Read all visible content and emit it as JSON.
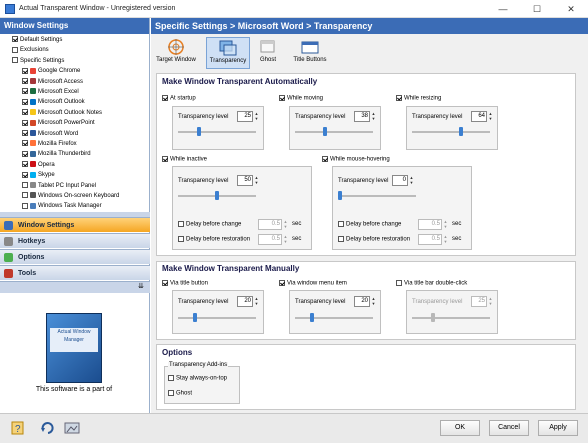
{
  "window": {
    "title": "Actual Transparent Window - Unregistered version",
    "min": "—",
    "max": "☐",
    "close": "✕"
  },
  "left": {
    "title": "Window Settings",
    "tree": [
      {
        "label": "Default Settings",
        "checked": true,
        "indent": 0
      },
      {
        "label": "Exclusions",
        "checked": false,
        "indent": 0
      },
      {
        "label": "Specific Settings",
        "checked": false,
        "indent": 0
      },
      {
        "label": "Google Chrome",
        "checked": true,
        "indent": 1,
        "color": "#e94235"
      },
      {
        "label": "Microsoft Access",
        "checked": true,
        "indent": 1,
        "color": "#a4373a"
      },
      {
        "label": "Microsoft Excel",
        "checked": true,
        "indent": 1,
        "color": "#1d6f42"
      },
      {
        "label": "Microsoft Outlook",
        "checked": true,
        "indent": 1,
        "color": "#0072c6"
      },
      {
        "label": "Microsoft Outlook Notes",
        "checked": true,
        "indent": 1,
        "color": "#f5c518"
      },
      {
        "label": "Microsoft PowerPoint",
        "checked": true,
        "indent": 1,
        "color": "#d24726"
      },
      {
        "label": "Microsoft Word",
        "checked": true,
        "indent": 1,
        "color": "#2b579a"
      },
      {
        "label": "Mozilla Firefox",
        "checked": true,
        "indent": 1,
        "color": "#ff7139"
      },
      {
        "label": "Mozilla Thunderbird",
        "checked": true,
        "indent": 1,
        "color": "#336699"
      },
      {
        "label": "Opera",
        "checked": true,
        "indent": 1,
        "color": "#cc0f16"
      },
      {
        "label": "Skype",
        "checked": true,
        "indent": 1,
        "color": "#00aff0"
      },
      {
        "label": "Tablet PC Input Panel",
        "checked": false,
        "indent": 1,
        "color": "#888888"
      },
      {
        "label": "Windows On-screen Keyboard",
        "checked": false,
        "indent": 1,
        "color": "#555555"
      },
      {
        "label": "Windows Task Manager",
        "checked": false,
        "indent": 1,
        "color": "#4a7ebb"
      }
    ],
    "nav": [
      "Window Settings",
      "Hotkeys",
      "Options",
      "Tools"
    ],
    "promo_box_text": "Actual Window Manager",
    "promo_text": "This software is a part of"
  },
  "right": {
    "breadcrumb": "Specific Settings > Microsoft Word > Transparency",
    "tools": [
      "Target Window",
      "Transparency",
      "Ghost",
      "Title Buttons"
    ],
    "auto": {
      "title": "Make Window Transparent Automatically",
      "startup": {
        "label": "At startup",
        "level_label": "Transparency level",
        "value": "25"
      },
      "moving": {
        "label": "While moving",
        "level_label": "Transparency level",
        "value": "38"
      },
      "resizing": {
        "label": "While resizing",
        "level_label": "Transparency level",
        "value": "64"
      },
      "inactive": {
        "label": "While inactive",
        "level_label": "Transparency level",
        "value": "50",
        "delay_change": "Delay before change",
        "delay_change_val": "0.5",
        "delay_restore": "Delay before restoration",
        "delay_restore_val": "0.5",
        "unit": "sec"
      },
      "hovering": {
        "label": "While mouse-hovering",
        "level_label": "Transparency level",
        "value": "0",
        "delay_change": "Delay before change",
        "delay_change_val": "0.5",
        "delay_restore": "Delay before restoration",
        "delay_restore_val": "0.5",
        "unit": "sec"
      }
    },
    "manual": {
      "title": "Make Window Transparent Manually",
      "title_button": {
        "label": "Via title button",
        "level_label": "Transparency level",
        "value": "20"
      },
      "menu_item": {
        "label": "Via window menu item",
        "level_label": "Transparency level",
        "value": "20"
      },
      "dblclick": {
        "label": "Via title bar double-click",
        "level_label": "Transparency level",
        "value": "25"
      }
    },
    "options": {
      "title": "Options",
      "addins": "Transparency Add-ins",
      "always_on_top": "Stay always-on-top",
      "ghost": "Ghost"
    }
  },
  "buttons": {
    "ok": "OK",
    "cancel": "Cancel",
    "apply": "Apply"
  }
}
